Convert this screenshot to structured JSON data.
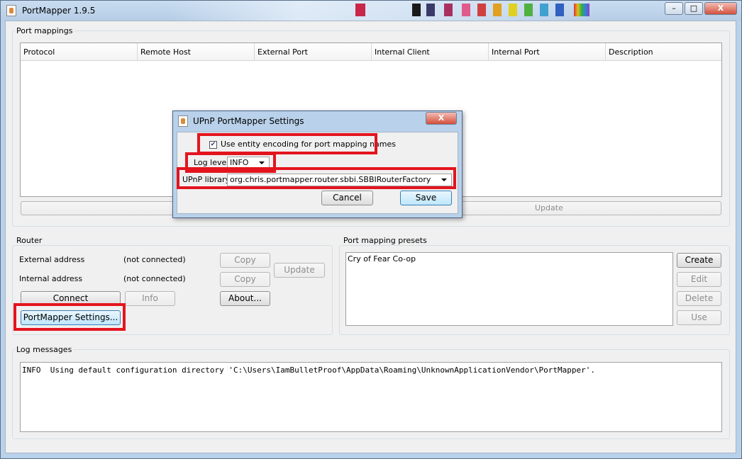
{
  "window": {
    "title": "PortMapper 1.9.5",
    "controls": {
      "minimize": "–",
      "maximize": "□",
      "close": "X"
    }
  },
  "port_mappings": {
    "label": "Port mappings",
    "columns": [
      "Protocol",
      "Remote Host",
      "External Port",
      "Internal Client",
      "Internal Port",
      "Description"
    ],
    "update_button": "Update"
  },
  "router": {
    "label": "Router",
    "external_address_label": "External address",
    "external_address_value": "(not connected)",
    "internal_address_label": "Internal address",
    "internal_address_value": "(not connected)",
    "copy_label": "Copy",
    "update_label": "Update",
    "connect_label": "Connect",
    "info_label": "Info",
    "about_label": "About...",
    "settings_label": "PortMapper Settings..."
  },
  "presets": {
    "label": "Port mapping presets",
    "items": [
      "Cry of Fear Co-op"
    ],
    "create": "Create",
    "edit": "Edit",
    "delete": "Delete",
    "use": "Use"
  },
  "log": {
    "label": "Log messages",
    "text": "INFO  Using default configuration directory 'C:\\Users\\IamBulletProof\\AppData\\Roaming\\UnknownApplicationVendor\\PortMapper'."
  },
  "dialog": {
    "title": "UPnP PortMapper Settings",
    "close": "X",
    "entity_encoding_label": "Use entity encoding for port mapping names",
    "entity_encoding_checked": true,
    "log_level_label": "Log level",
    "log_level_value": "INFO",
    "upnp_library_label": "UPnP library",
    "upnp_library_value": "org.chris.portmapper.router.sbbi.SBBIRouterFactory",
    "cancel": "Cancel",
    "save": "Save"
  },
  "colors": {
    "highlight": "#e3141e",
    "title_bar": "#b9d1ea"
  }
}
